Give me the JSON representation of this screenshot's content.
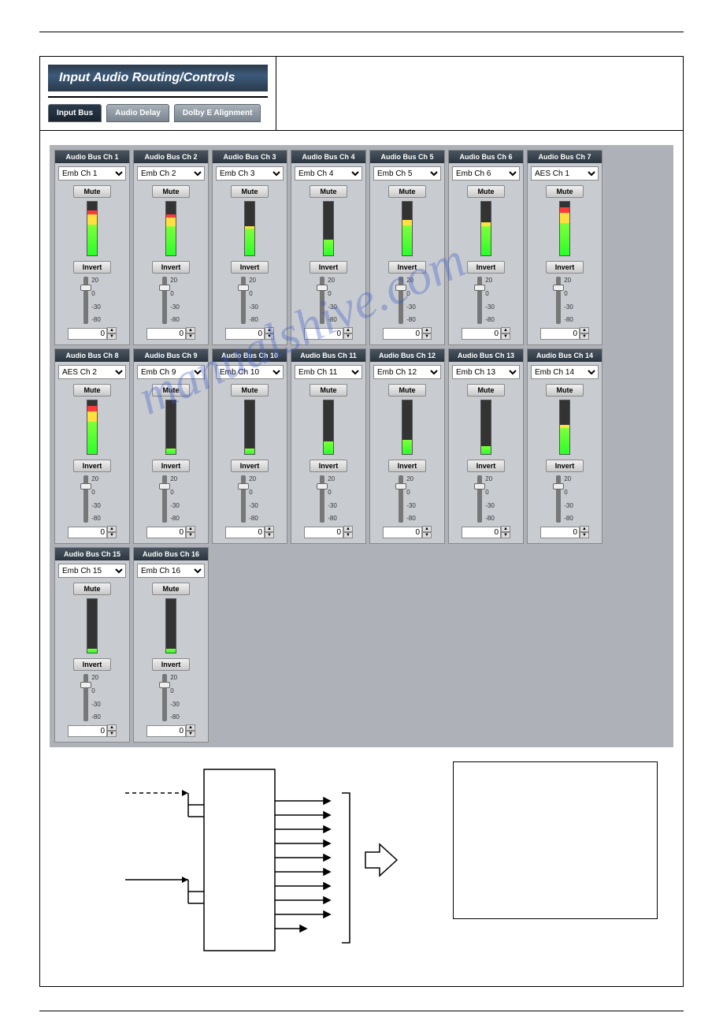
{
  "watermark": "manualshive.com",
  "titleBanner": "Input Audio Routing/Controls",
  "tabs": [
    {
      "label": "Input Bus",
      "active": true
    },
    {
      "label": "Audio Delay",
      "active": false
    },
    {
      "label": "Dolby E Alignment",
      "active": false
    }
  ],
  "defaults": {
    "muteLabel": "Mute",
    "invertLabel": "Invert",
    "scale": [
      "20",
      "0",
      "-30",
      "-80"
    ]
  },
  "channels": [
    {
      "title": "Audio Bus Ch 1",
      "source": "Emb Ch 1",
      "meterGreen": 58,
      "meterYellow": 18,
      "meterRed": 8,
      "gain": 0
    },
    {
      "title": "Audio Bus Ch 2",
      "source": "Emb Ch 2",
      "meterGreen": 55,
      "meterYellow": 16,
      "meterRed": 6,
      "gain": 0
    },
    {
      "title": "Audio Bus Ch 3",
      "source": "Emb Ch 3",
      "meterGreen": 50,
      "meterYellow": 4,
      "meterRed": 0,
      "gain": 0
    },
    {
      "title": "Audio Bus Ch 4",
      "source": "Emb Ch 4",
      "meterGreen": 30,
      "meterYellow": 0,
      "meterRed": 0,
      "gain": 0
    },
    {
      "title": "Audio Bus Ch 5",
      "source": "Emb Ch 5",
      "meterGreen": 56,
      "meterYellow": 10,
      "meterRed": 0,
      "gain": 0
    },
    {
      "title": "Audio Bus Ch 6",
      "source": "Emb Ch 6",
      "meterGreen": 54,
      "meterYellow": 8,
      "meterRed": 0,
      "gain": 0
    },
    {
      "title": "Audio Bus Ch 7",
      "source": "AES Ch 1",
      "meterGreen": 60,
      "meterYellow": 20,
      "meterRed": 10,
      "gain": 0
    },
    {
      "title": "Audio Bus Ch 8",
      "source": "AES Ch 2",
      "meterGreen": 60,
      "meterYellow": 20,
      "meterRed": 10,
      "gain": 0
    },
    {
      "title": "Audio Bus Ch 9",
      "source": "Emb Ch 9",
      "meterGreen": 10,
      "meterYellow": 0,
      "meterRed": 0,
      "gain": 0
    },
    {
      "title": "Audio Bus Ch 10",
      "source": "Emb Ch 10",
      "meterGreen": 10,
      "meterYellow": 0,
      "meterRed": 0,
      "gain": 0
    },
    {
      "title": "Audio Bus Ch 11",
      "source": "Emb Ch 11",
      "meterGreen": 24,
      "meterYellow": 0,
      "meterRed": 0,
      "gain": 0
    },
    {
      "title": "Audio Bus Ch 12",
      "source": "Emb Ch 12",
      "meterGreen": 26,
      "meterYellow": 0,
      "meterRed": 0,
      "gain": 0
    },
    {
      "title": "Audio Bus Ch 13",
      "source": "Emb Ch 13",
      "meterGreen": 14,
      "meterYellow": 0,
      "meterRed": 0,
      "gain": 0
    },
    {
      "title": "Audio Bus Ch 14",
      "source": "Emb Ch 14",
      "meterGreen": 48,
      "meterYellow": 6,
      "meterRed": 0,
      "gain": 0
    },
    {
      "title": "Audio Bus Ch 15",
      "source": "Emb Ch 15",
      "meterGreen": 8,
      "meterYellow": 0,
      "meterRed": 0,
      "gain": 0
    },
    {
      "title": "Audio Bus Ch 16",
      "source": "Emb Ch 16",
      "meterGreen": 8,
      "meterYellow": 0,
      "meterRed": 0,
      "gain": 0
    }
  ]
}
